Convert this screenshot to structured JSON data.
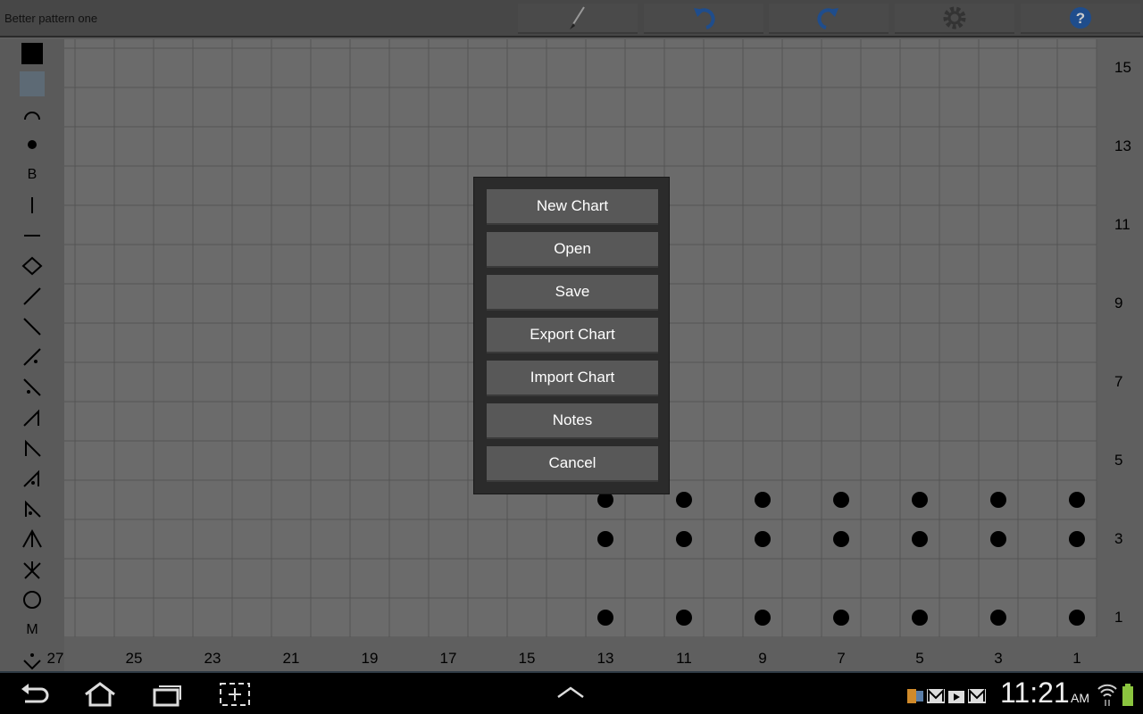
{
  "app": {
    "title": "Better pattern one"
  },
  "toolbar": [
    {
      "icon": "brush-icon"
    },
    {
      "icon": "undo-icon"
    },
    {
      "icon": "redo-icon"
    },
    {
      "icon": "gear-icon"
    },
    {
      "icon": "help-icon"
    }
  ],
  "tools": [
    "black-square",
    "blue-square",
    "arc",
    "dot",
    "B",
    "vertical-line",
    "horizontal-line",
    "diamond",
    "slash",
    "backslash",
    "slash-dot",
    "backslash-dot",
    "right-triangle-left",
    "right-triangle-right",
    "triangle-dot-left",
    "triangle-dot-right",
    "arrow-up",
    "arrow-down",
    "circle",
    "M",
    "chevron-dot"
  ],
  "tool_text": {
    "b": "B",
    "m": "M"
  },
  "grid": {
    "row_labels": [
      "15",
      "13",
      "11",
      "9",
      "7",
      "5",
      "3",
      "1"
    ],
    "column_labels": [
      "27",
      "25",
      "23",
      "21",
      "19",
      "17",
      "15",
      "13",
      "11",
      "9",
      "7",
      "5",
      "3",
      "1"
    ],
    "rows": 15,
    "columns": 27,
    "stitches": [
      {
        "row": 4,
        "cols": [
          13,
          11,
          9,
          7,
          5,
          3,
          1
        ]
      },
      {
        "row": 3,
        "cols": [
          13,
          11,
          9,
          7,
          5,
          3,
          1
        ]
      },
      {
        "row": 1,
        "cols": [
          13,
          11,
          9,
          7,
          5,
          3,
          1
        ]
      }
    ]
  },
  "dialog": {
    "buttons": [
      "New Chart",
      "Open",
      "Save",
      "Export Chart",
      "Import Chart",
      "Notes",
      "Cancel"
    ]
  },
  "status": {
    "time": "11:21",
    "ampm": "AM",
    "accent": "#8bc53f"
  }
}
